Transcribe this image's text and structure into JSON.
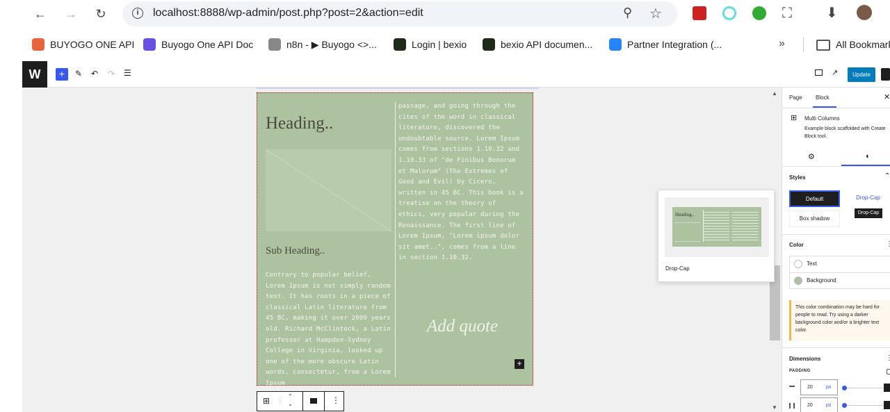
{
  "browser": {
    "url": "localhost:8888/wp-admin/post.php?post=2&action=edit",
    "bookmarks": [
      {
        "label": "BUYOGO ONE API",
        "color": "#e8643c"
      },
      {
        "label": "Buyogo One API Doc",
        "color": "#6c4fe0"
      },
      {
        "label": "n8n - ▶ Buyogo <>...",
        "color": "#888888"
      },
      {
        "label": "Login | bexio",
        "color": "#1d2b1b"
      },
      {
        "label": "bexio API documen...",
        "color": "#1d2b1b"
      },
      {
        "label": "Partner Integration (...",
        "color": "#2684ff"
      }
    ],
    "more_bookmarks": "»",
    "all_bookmarks": "All Bookmarks"
  },
  "toolbar": {
    "update_label": "Update"
  },
  "block": {
    "heading": "Heading..",
    "sub_heading": "Sub Heading..",
    "col1_text": "Contrary to popular belief, Lorem Ipsum is not simply random text. It has roots in a piece of classical Latin literature from 45 BC, making it over 2000 years old. Richard McClintock, a Latin professor at Hampden-Sydney College in Virginia, looked up one of the more obscure Latin words, consectetur, from a Lorem Ipsum",
    "col2_text": "passage, and going through the cites of the word in classical literature, discovered the undoubtable source. Lorem Ipsum comes from sections 1.10.32 and 1.10.33 of \"de Finibus Bonorum et Malorum\" (The Extremes of Good and Evil) by Cicero, written in 45 BC. This book is a treatise on the theory of ethics, very popular during the Renaissance. The first line of Lorem Ipsum, \"Lorem ipsum dolor sit amet..\", comes from a line in section 1.10.32.",
    "quote_placeholder": "Add quote",
    "background": "#adc29f"
  },
  "popover": {
    "preview_heading": "Heading..",
    "caption": "Drop-Cap"
  },
  "sidebar": {
    "tabs": [
      "Page",
      "Block"
    ],
    "block_name": "Multi Columns",
    "block_desc": "Example block scaffolded with Create Block tool.",
    "styles_title": "Styles",
    "styles": [
      "Default",
      "Drop-Cap",
      "Box shadow"
    ],
    "tooltip": "Drop-Cap",
    "color_title": "Color",
    "color_items": [
      "Text",
      "Background"
    ],
    "warning": "This color combination may be hard for people to read. Try using a darker background color and/or a brighter text color.",
    "dimensions_title": "Dimensions",
    "padding_label": "PADDING",
    "padding_values": [
      "20",
      "20"
    ],
    "unit": "px"
  }
}
